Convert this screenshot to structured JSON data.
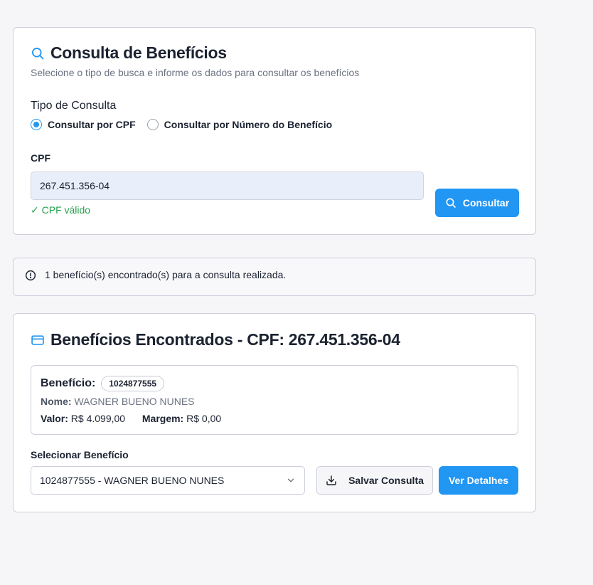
{
  "colors": {
    "accent": "#2196f3",
    "success": "#22a04b",
    "muted": "#6b7280",
    "text": "#1b2230"
  },
  "search": {
    "title": "Consulta de Benefícios",
    "subtitle": "Selecione o tipo de busca e informe os dados para consultar os benefícios",
    "type_label": "Tipo de Consulta",
    "options": [
      {
        "label": "Consultar por CPF",
        "checked": true
      },
      {
        "label": "Consultar por Número do Benefício",
        "checked": false
      }
    ],
    "cpf_label": "CPF",
    "cpf_value": "267.451.356-04",
    "validation": "✓ CPF válido",
    "button": "Consultar",
    "icons": {
      "title": "search-icon",
      "button": "search-icon"
    }
  },
  "alert": {
    "icon": "alert-circle-icon",
    "text": "1 benefício(s) encontrado(s) para a consulta realizada."
  },
  "results": {
    "icon": "credit-card-icon",
    "title": "Benefícios Encontrados - CPF: 267.451.356-04",
    "benefit": {
      "label": "Benefício:",
      "number": "1024877555",
      "name_label": "Nome:",
      "name": "WAGNER BUENO NUNES",
      "value_label": "Valor:",
      "value": "R$ 4.099,00",
      "margin_label": "Margem:",
      "margin": "R$ 0,00"
    },
    "select_label": "Selecionar Benefício",
    "select_value": "1024877555 - WAGNER BUENO NUNES",
    "save_button": "Salvar Consulta",
    "details_button": "Ver Detalhes"
  }
}
